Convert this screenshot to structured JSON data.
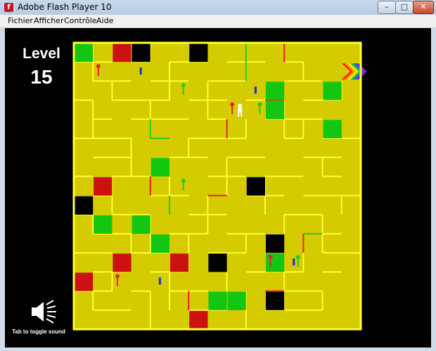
{
  "window": {
    "title": "Adobe Flash Player 10",
    "app_icon": "f",
    "minimize_icon": "minimize-icon",
    "maximize_icon": "maximize-icon",
    "close_icon": "close-icon"
  },
  "menu": {
    "items": [
      "Fichier",
      "Afficher",
      "Contrôle",
      "Aide"
    ]
  },
  "game": {
    "level_label": "Level",
    "level_number": "15",
    "sound_hint": "Tab to toggle sound",
    "sound_icon": "speaker-icon",
    "colors": {
      "background": "#000000",
      "floor": "#d4cb00",
      "wall": "#ffff33",
      "green_block": "#12c612",
      "red_block": "#cc1111",
      "black_block": "#000000",
      "green_gate": "#22cc22",
      "red_gate": "#ee2222",
      "red_key": "#ee2222",
      "green_key": "#22cc22",
      "blue_pickup": "#1133cc",
      "player": "#ffffff"
    },
    "grid": {
      "cols": 15,
      "rows": 15
    },
    "green_blocks": [
      [
        0,
        0
      ],
      [
        10,
        2
      ],
      [
        13,
        2
      ],
      [
        10,
        3
      ],
      [
        13,
        4
      ],
      [
        4,
        6
      ],
      [
        1,
        9
      ],
      [
        3,
        9
      ],
      [
        4,
        10
      ],
      [
        10,
        11
      ],
      [
        7,
        13
      ],
      [
        8,
        13
      ]
    ],
    "red_blocks": [
      [
        2,
        0
      ],
      [
        1,
        7
      ],
      [
        2,
        11
      ],
      [
        5,
        11
      ],
      [
        0,
        12
      ],
      [
        6,
        14
      ]
    ],
    "black_blocks": [
      [
        3,
        0
      ],
      [
        6,
        0
      ],
      [
        9,
        7
      ],
      [
        0,
        8
      ],
      [
        10,
        10
      ],
      [
        7,
        11
      ],
      [
        10,
        13
      ]
    ],
    "goal": {
      "cell": [
        14,
        1
      ],
      "label": "rainbow-exit"
    },
    "player": {
      "cell": [
        8,
        3
      ]
    },
    "red_keys": [
      [
        1,
        1
      ],
      [
        8,
        3
      ],
      [
        2,
        12
      ],
      [
        10,
        11
      ]
    ],
    "green_keys": [
      [
        5,
        2
      ],
      [
        9,
        3
      ],
      [
        5,
        7
      ],
      [
        11,
        11
      ]
    ],
    "blue_pickups": [
      [
        3,
        1
      ],
      [
        9,
        2
      ],
      [
        11,
        11
      ],
      [
        4,
        12
      ]
    ]
  }
}
